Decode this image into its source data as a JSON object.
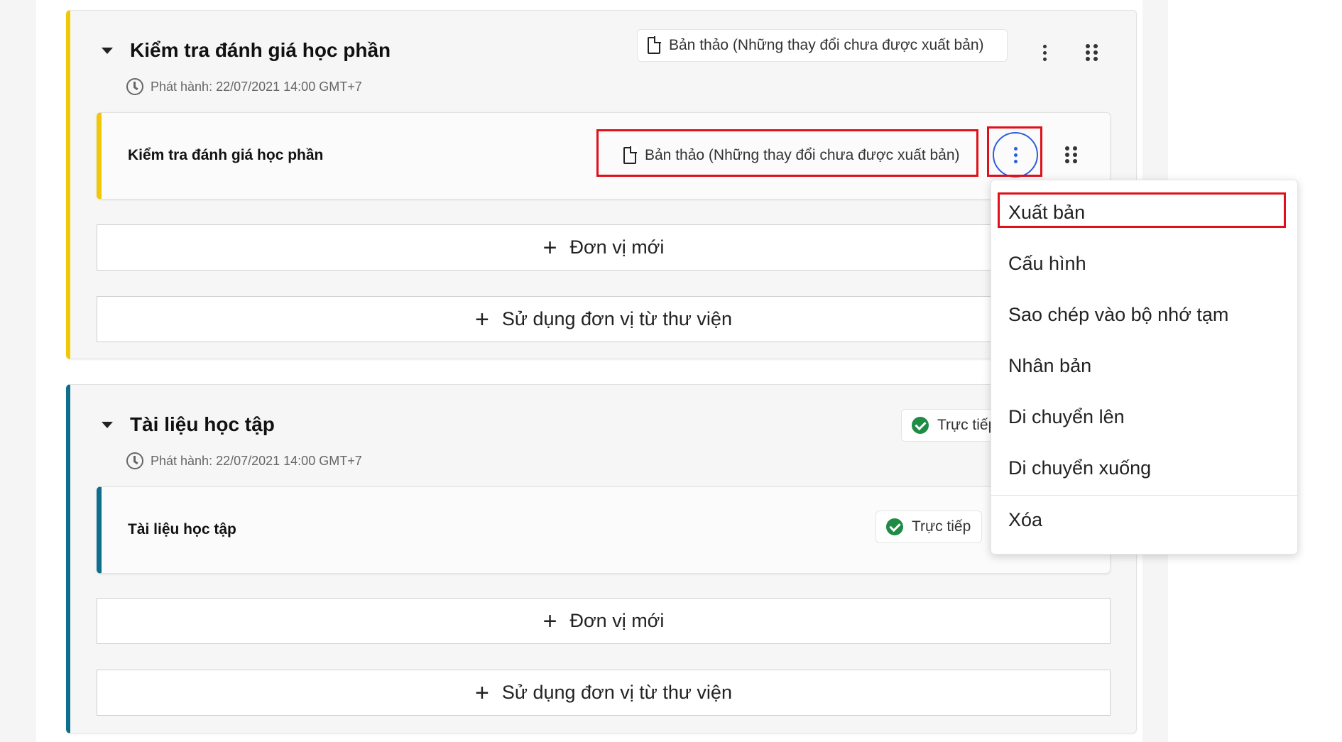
{
  "colors": {
    "section1_accent": "#f0c808",
    "section2_accent": "#0e6e8e",
    "highlight": "#e0101a",
    "active_ring": "#2d5ed8",
    "live_check": "#1e8c45"
  },
  "sections": [
    {
      "title": "Kiểm tra đánh giá học phần",
      "release": "Phát hành: 22/07/2021 14:00 GMT+7",
      "status": "Bản thảo (Những thay đổi chưa được xuất bản)",
      "status_icon": "document-icon",
      "unit": {
        "title": "Kiểm tra đánh giá học phần",
        "status": "Bản thảo (Những thay đổi chưa được xuất bản)",
        "status_icon": "document-icon"
      },
      "new_unit_label": "Đơn vị mới",
      "library_label": "Sử dụng đơn vị từ thư viện"
    },
    {
      "title": "Tài liệu học tập",
      "release": "Phát hành: 22/07/2021 14:00 GMT+7",
      "status": "Trực tiếp",
      "status_icon": "check-circle-icon",
      "unit": {
        "title": "Tài liệu học tập",
        "status": "Trực tiếp",
        "status_icon": "check-circle-icon"
      },
      "new_unit_label": "Đơn vị mới",
      "library_label": "Sử dụng đơn vị từ thư viện"
    }
  ],
  "context_menu": {
    "items": [
      "Xuất bản",
      "Cấu hình",
      "Sao chép vào bộ nhớ tạm",
      "Nhân bản",
      "Di chuyển lên",
      "Di chuyển xuống"
    ],
    "danger_item": "Xóa"
  }
}
